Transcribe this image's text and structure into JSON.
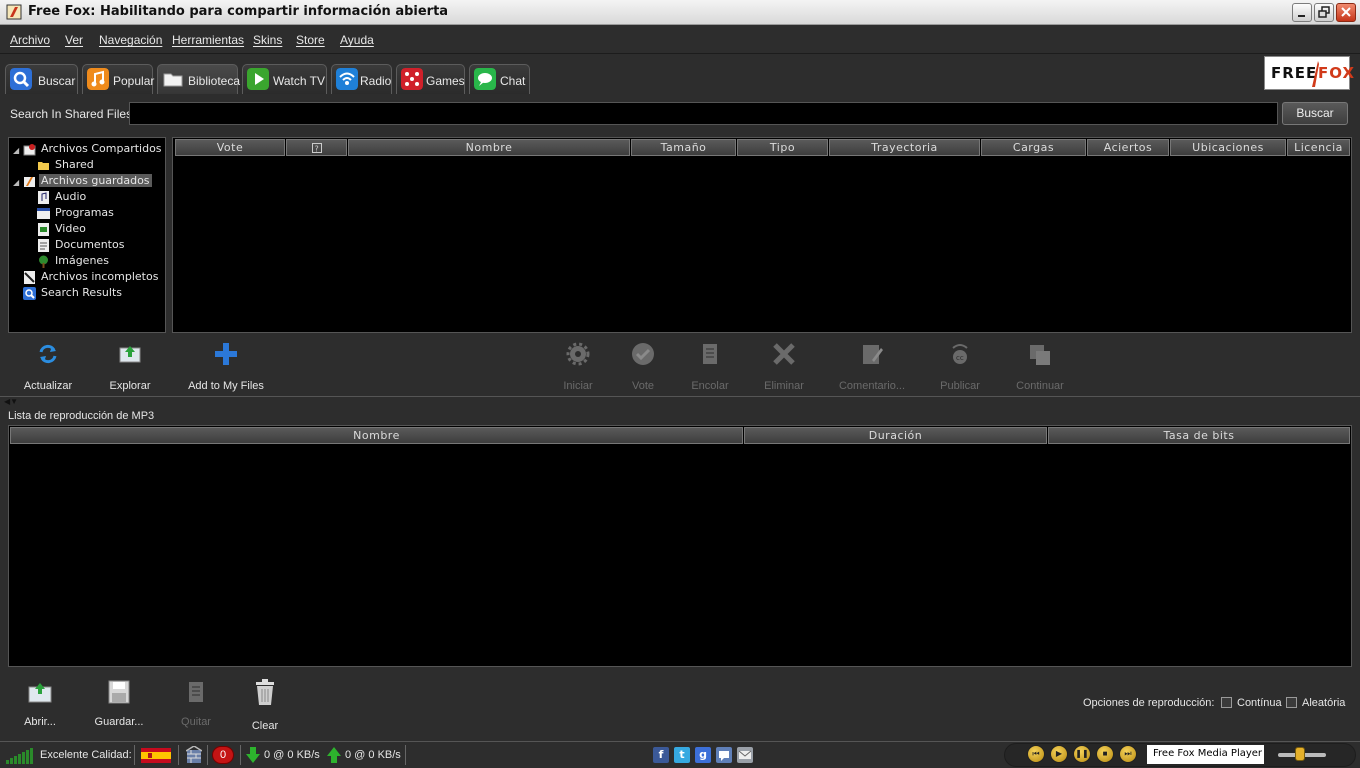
{
  "window": {
    "title": "Free Fox: Habilitando para compartir información abierta"
  },
  "menu": [
    "Archivo",
    "Ver",
    "Navegación",
    "Herramientas",
    "Skins",
    "Store",
    "Ayuda"
  ],
  "tabs": [
    {
      "label": "Buscar",
      "icon": "search-icon",
      "color": "#2d6fd6"
    },
    {
      "label": "Popular",
      "icon": "music-icon",
      "color": "#ef8b1c"
    },
    {
      "label": "Biblioteca",
      "icon": "folder-icon",
      "color": "#f0f0f0"
    },
    {
      "label": "Watch TV",
      "icon": "play-icon",
      "color": "#3aa52e"
    },
    {
      "label": "Radio",
      "icon": "wifi-icon",
      "color": "#1f80d8"
    },
    {
      "label": "Games",
      "icon": "dice-icon",
      "color": "#d0202a"
    },
    {
      "label": "Chat",
      "icon": "chat-icon",
      "color": "#29b64a"
    }
  ],
  "logo": {
    "text1": "FREE",
    "text2": "FOX"
  },
  "search": {
    "label": "Search In Shared Files:",
    "value": "",
    "button": "Buscar"
  },
  "tree": {
    "shared_root": "Archivos Compartidos",
    "shared_child": "Shared",
    "saved_root": "Archivos guardados",
    "saved_children": [
      "Audio",
      "Programas",
      "Video",
      "Documentos",
      "Imágenes"
    ],
    "incomplete": "Archivos incompletos",
    "search_results": "Search Results"
  },
  "files_table": {
    "columns": [
      "Vote",
      "?",
      "Nombre",
      "Tamaño",
      "Tipo",
      "Trayectoria",
      "Cargas",
      "Aciertos",
      "Ubicaciones",
      "Licencia"
    ],
    "rows": []
  },
  "toolbar": {
    "actualizar": "Actualizar",
    "explorar": "Explorar",
    "add": "Add to My Files",
    "iniciar": "Iniciar",
    "vote": "Vote",
    "encolar": "Encolar",
    "eliminar": "Eliminar",
    "comentario": "Comentario...",
    "publicar": "Publicar",
    "continuar": "Continuar"
  },
  "playlist": {
    "title": "Lista de reproducción de MP3",
    "columns": [
      "Nombre",
      "Duración",
      "Tasa de bits"
    ],
    "rows": []
  },
  "playlist_buttons": {
    "abrir": "Abrir...",
    "guardar": "Guardar...",
    "quitar": "Quitar",
    "clear": "Clear"
  },
  "playback_options": {
    "label": "Opciones de reproducción:",
    "continua": "Contínua",
    "aleatoria": "Aleatória",
    "continua_checked": false,
    "aleatoria_checked": false
  },
  "status": {
    "quality": "Excelente Calidad:",
    "notifications": "0",
    "download": "0 @ 0 KB/s",
    "upload": "0 @ 0 KB/s",
    "player_name": "Free Fox Media Player"
  },
  "colors": {
    "background": "#2d2d2d",
    "panel": "#000000",
    "accent": "#e5b02a"
  }
}
